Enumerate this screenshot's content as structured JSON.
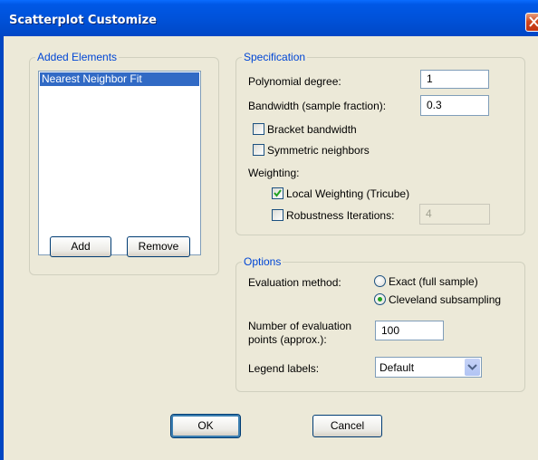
{
  "window": {
    "title": "Scatterplot Customize"
  },
  "added_elements": {
    "legend": "Added Elements",
    "items": [
      "Nearest Neighbor Fit"
    ],
    "add_label": "Add",
    "remove_label": "Remove"
  },
  "specification": {
    "legend": "Specification",
    "polynomial_degree_label": "Polynomial degree:",
    "polynomial_degree_value": "1",
    "bandwidth_label": "Bandwidth (sample fraction):",
    "bandwidth_value": "0.3",
    "bracket_bandwidth_label": "Bracket bandwidth",
    "bracket_bandwidth_checked": false,
    "symmetric_neighbors_label": "Symmetric neighbors",
    "symmetric_neighbors_checked": false,
    "weighting_label": "Weighting:",
    "local_weighting_label": "Local Weighting (Tricube)",
    "local_weighting_checked": true,
    "robustness_label": "Robustness Iterations:",
    "robustness_checked": false,
    "robustness_value": "4"
  },
  "options": {
    "legend": "Options",
    "evaluation_method_label": "Evaluation method:",
    "radio_exact_label": "Exact (full sample)",
    "radio_cleveland_label": "Cleveland subsampling",
    "selected_method": "Cleveland subsampling",
    "num_points_label_line1": "Number of evaluation",
    "num_points_label_line2": "points (approx.):",
    "num_points_value": "100",
    "legend_labels_label": "Legend labels:",
    "legend_labels_value": "Default"
  },
  "footer": {
    "ok_label": "OK",
    "cancel_label": "Cancel"
  },
  "colors": {
    "titlebar": "#0054e3",
    "group_legend": "#0046d5",
    "selection": "#316ac5",
    "dialog_bg": "#ece9d8"
  }
}
